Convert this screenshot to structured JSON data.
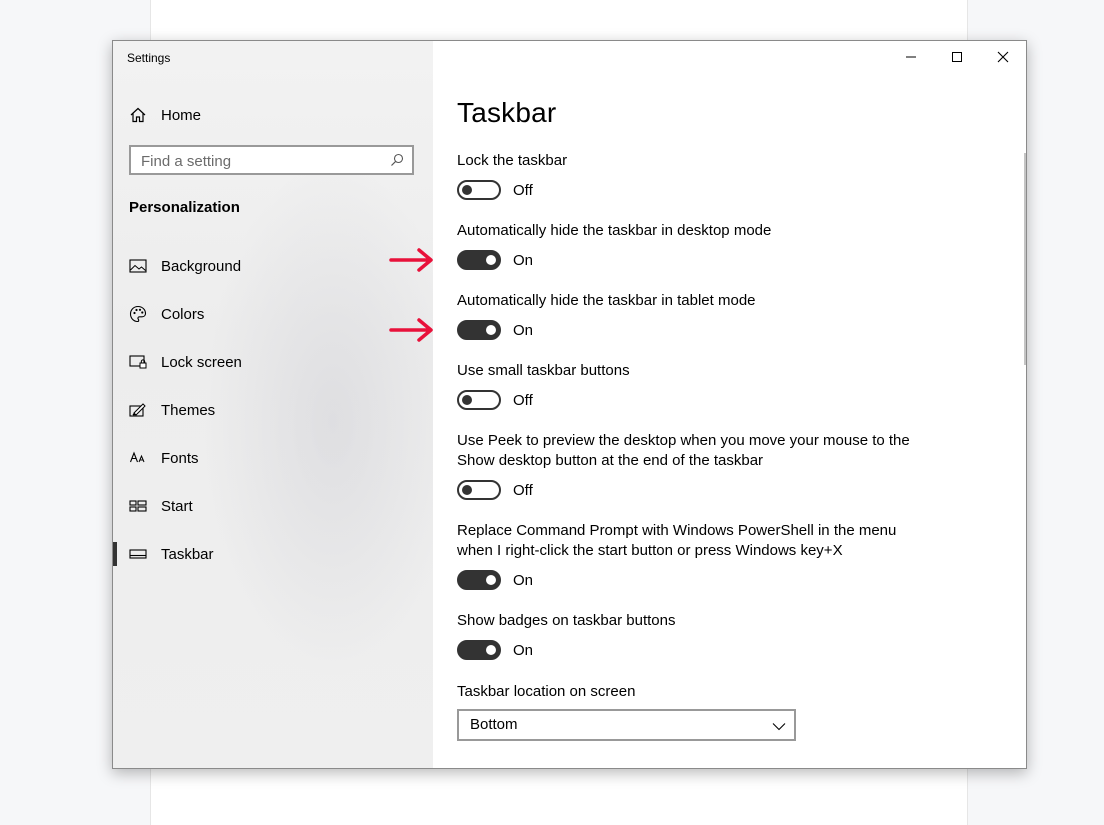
{
  "window": {
    "title": "Settings",
    "controls": [
      "minimize",
      "maximize",
      "close"
    ]
  },
  "sidebar": {
    "home_label": "Home",
    "search": {
      "placeholder": "Find a setting",
      "value": ""
    },
    "section_title": "Personalization",
    "items": [
      {
        "label": "Background",
        "icon": "picture-icon",
        "active": false
      },
      {
        "label": "Colors",
        "icon": "palette-icon",
        "active": false
      },
      {
        "label": "Lock screen",
        "icon": "lock-screen-icon",
        "active": false
      },
      {
        "label": "Themes",
        "icon": "themes-icon",
        "active": false
      },
      {
        "label": "Fonts",
        "icon": "fonts-icon",
        "active": false
      },
      {
        "label": "Start",
        "icon": "start-icon",
        "active": false
      },
      {
        "label": "Taskbar",
        "icon": "taskbar-icon",
        "active": true
      }
    ]
  },
  "main": {
    "title": "Taskbar",
    "settings": [
      {
        "desc": "Lock the taskbar",
        "state": "Off"
      },
      {
        "desc": "Automatically hide the taskbar in desktop mode",
        "state": "On"
      },
      {
        "desc": "Automatically hide the taskbar in tablet mode",
        "state": "On"
      },
      {
        "desc": "Use small taskbar buttons",
        "state": "Off"
      },
      {
        "desc": "Use Peek to preview the desktop when you move your mouse to the Show desktop button at the end of the taskbar",
        "state": "Off"
      },
      {
        "desc": "Replace Command Prompt with Windows PowerShell in the menu when I right-click the start button or press Windows key+X",
        "state": "On"
      },
      {
        "desc": "Show badges on taskbar buttons",
        "state": "On"
      }
    ],
    "location": {
      "label": "Taskbar location on screen",
      "value": "Bottom"
    }
  },
  "annotation": {
    "arrow_color": "#e8113a"
  },
  "colors": {
    "toggle_on": "#333333",
    "sidebar_bg": "#f2f2f2"
  }
}
